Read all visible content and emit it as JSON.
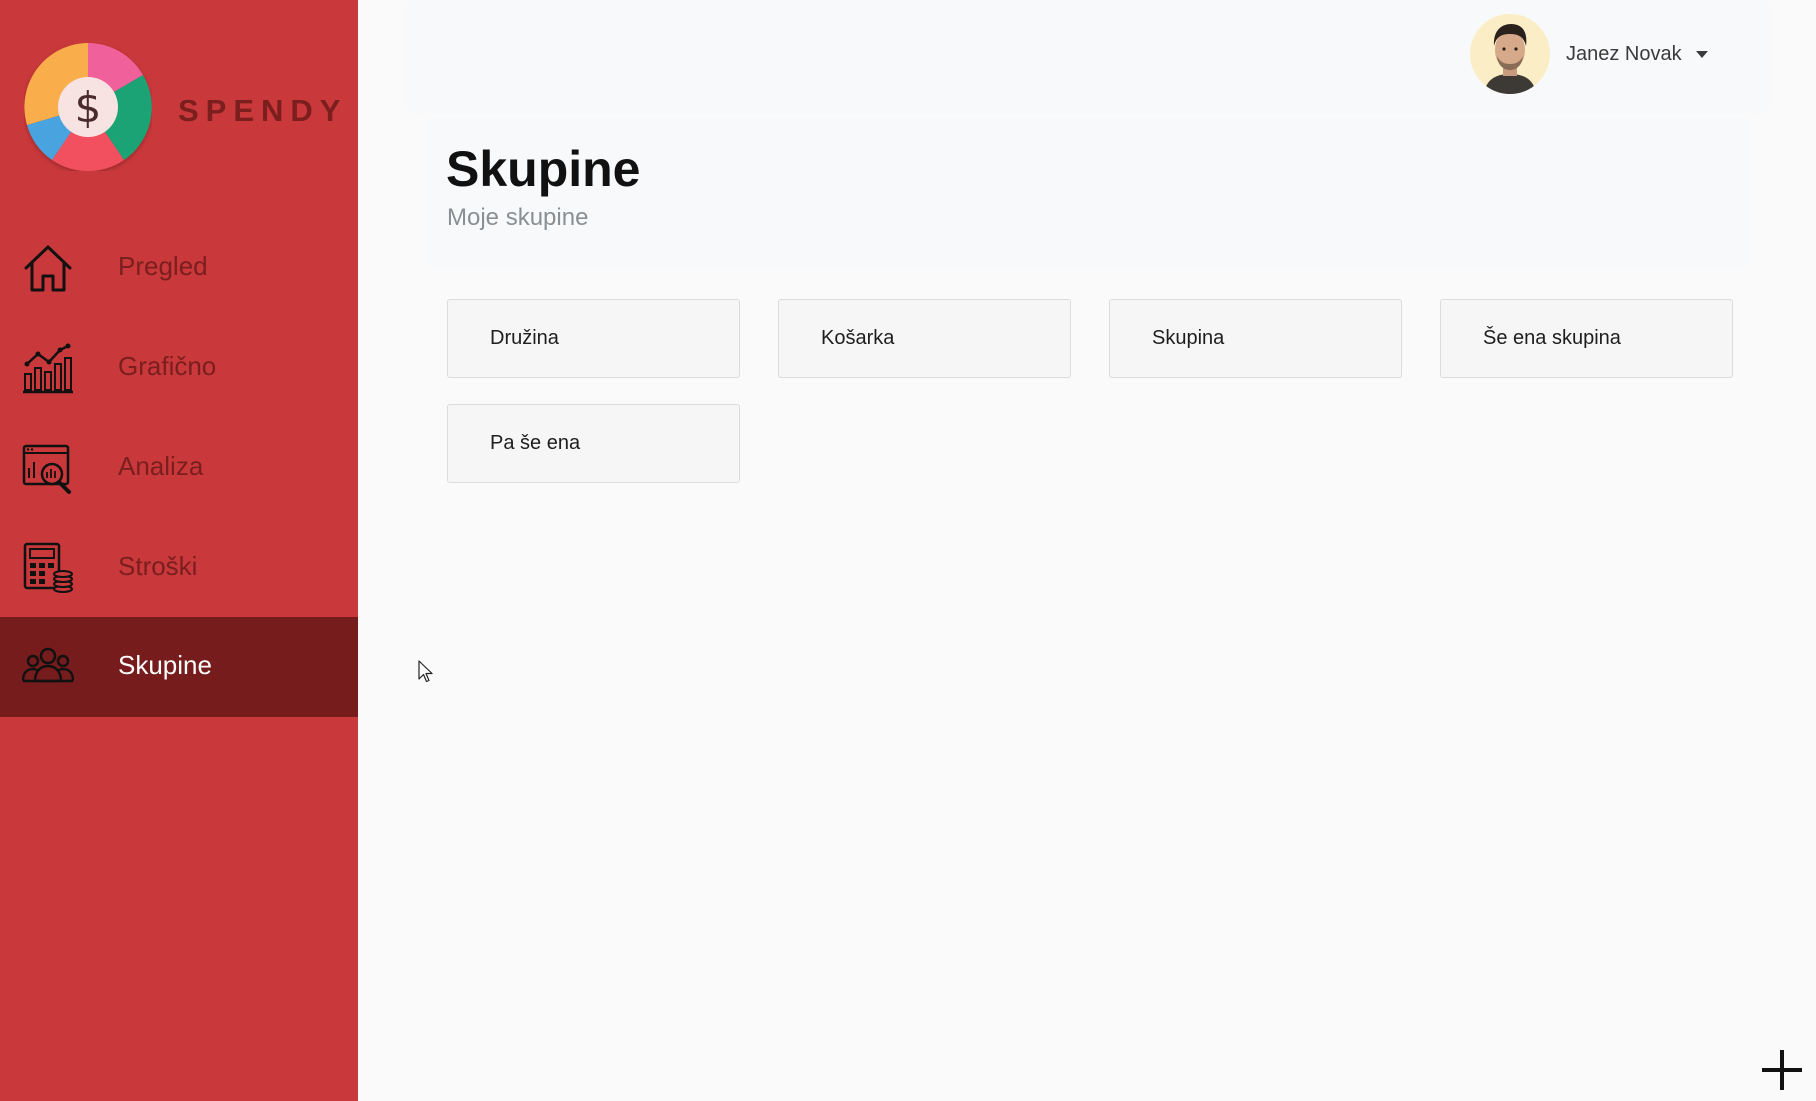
{
  "app": {
    "brand": "SPENDY",
    "brand_color": "#c9383a"
  },
  "sidebar": {
    "items": [
      {
        "label": "Pregled",
        "icon": "home-icon"
      },
      {
        "label": "Grafično",
        "icon": "chart-icon"
      },
      {
        "label": "Analiza",
        "icon": "analysis-icon"
      },
      {
        "label": "Stroški",
        "icon": "calculator-coins-icon"
      },
      {
        "label": "Skupine",
        "icon": "users-group-icon",
        "active": true
      }
    ]
  },
  "header": {
    "user_name": "Janez Novak",
    "user_icon": "avatar",
    "dropdown_icon": "caret-down-icon"
  },
  "page": {
    "title": "Skupine",
    "subtitle": "Moje skupine"
  },
  "groups": [
    {
      "name": "Družina"
    },
    {
      "name": "Košarka"
    },
    {
      "name": "Skupina"
    },
    {
      "name": "Še ena skupina"
    },
    {
      "name": "Pa še ena"
    }
  ],
  "fab": {
    "icon": "plus-icon"
  }
}
